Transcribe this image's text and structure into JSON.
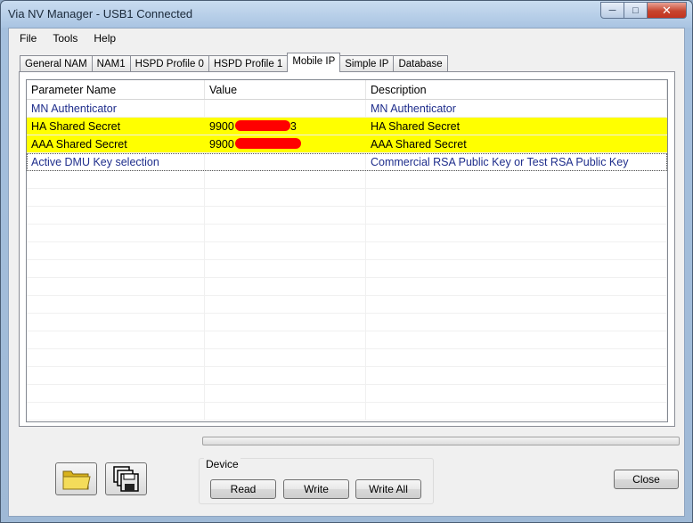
{
  "window": {
    "title": "Via NV Manager - USB1 Connected"
  },
  "menu": [
    "File",
    "Tools",
    "Help"
  ],
  "tabs": [
    {
      "label": "General NAM",
      "active": false
    },
    {
      "label": "NAM1",
      "active": false
    },
    {
      "label": "HSPD Profile 0",
      "active": false
    },
    {
      "label": "HSPD Profile 1",
      "active": false
    },
    {
      "label": "Mobile IP",
      "active": true
    },
    {
      "label": "Simple IP",
      "active": false
    },
    {
      "label": "Database",
      "active": false
    }
  ],
  "table": {
    "columns": [
      "Parameter Name",
      "Value",
      "Description"
    ],
    "rows": [
      {
        "name": "MN Authenticator",
        "value": "",
        "description": "MN Authenticator",
        "highlighted": false
      },
      {
        "name": "HA Shared Secret",
        "value": "9900",
        "value_suffix": "3",
        "description": "HA Shared Secret",
        "highlighted": true
      },
      {
        "name": "AAA Shared Secret",
        "value": "9900",
        "value_suffix": "",
        "description": "AAA Shared Secret",
        "highlighted": true
      },
      {
        "name": "Active DMU Key selection",
        "value": "",
        "description": "Commercial RSA Public Key or Test RSA Public Key",
        "highlighted": false
      }
    ]
  },
  "device": {
    "group_label": "Device",
    "read_label": "Read",
    "write_label": "Write",
    "write_all_label": "Write All"
  },
  "close_label": "Close",
  "colors": {
    "highlight": "#ffff00",
    "value_text": "#1f2e8c",
    "redaction": "#ff0000"
  }
}
